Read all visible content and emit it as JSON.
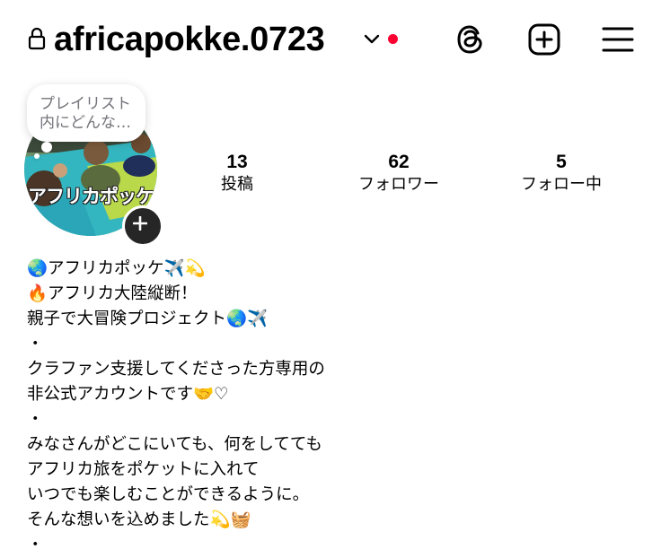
{
  "header": {
    "username": "africapokke.0723",
    "icons": [
      "lock-icon",
      "chevron-down-icon",
      "threads-icon",
      "create-post-icon",
      "menu-icon"
    ],
    "notification_dot_color": "#ff0033"
  },
  "note": {
    "text": "プレイリスト\n内にどんな…"
  },
  "avatar": {
    "caption": "アフリカポッケ",
    "add_icon": "plus-icon"
  },
  "stats": [
    {
      "value": "13",
      "label": "投稿"
    },
    {
      "value": "62",
      "label": "フォロワー"
    },
    {
      "value": "5",
      "label": "フォロー中"
    }
  ],
  "bio": {
    "lines": [
      "🌏アフリカポッケ✈️💫",
      "🔥アフリカ大陸縦断！",
      "親子で大冒険プロジェクト🌏✈️",
      "・",
      "クラファン支援してくださった方専用の",
      "非公式アカウントです🤝♡",
      "・",
      "みなさんがどこにいても、何をしてても",
      "アフリカ旅をポケットに入れて",
      "いつでも楽しむことができるように。",
      "そんな想いを込めました💫🧺",
      "・"
    ]
  }
}
